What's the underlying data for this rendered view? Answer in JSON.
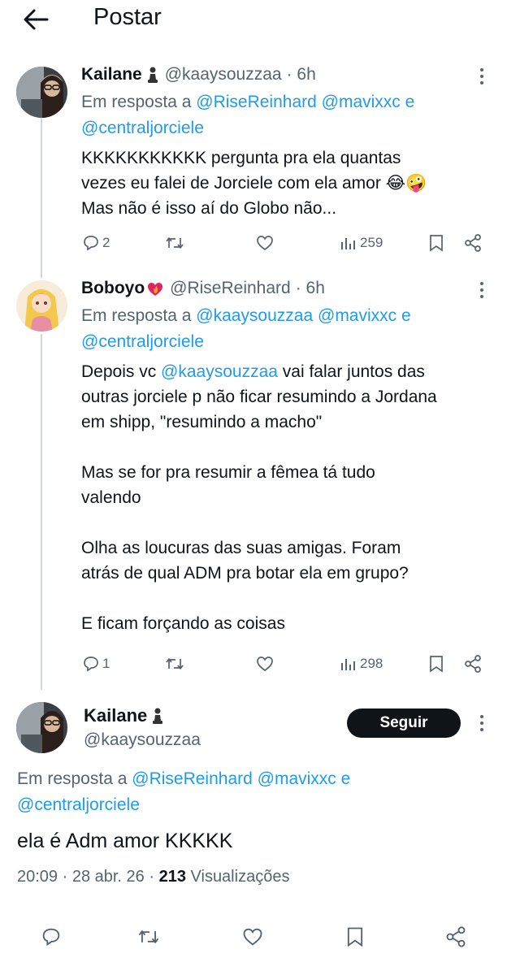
{
  "header": {
    "title": "Postar"
  },
  "posts": [
    {
      "name": "Kailane",
      "handle": "@kaaysouzzaa",
      "time": "· 6h",
      "reply_prefix": "Em resposta a",
      "reply_mentions": [
        "@RiseReinhard",
        "@mavixxc"
      ],
      "reply_and": "e",
      "reply_last": "@centraljorciele",
      "text": "KKKKKKKKKKK pergunta pra ela quantas\nvezes eu falei de Jorciele com ela amor 😂🤪\nMas não é isso aí do Globo não...",
      "replies": "2",
      "reposts": "",
      "views": "259"
    },
    {
      "name": "Boboyo",
      "handle": "@RiseReinhard",
      "time": "· 6h",
      "reply_prefix": "Em resposta a",
      "reply_mentions": [
        "@kaaysouzzaa",
        "@mavixxc"
      ],
      "reply_and": "e",
      "reply_last": "@centraljorciele",
      "text_start": "Depois vc",
      "text_mention": "@kaaysouzzaa",
      "text_rest": "vai falar juntos das\noutras jorciele p não ficar resumindo a Jordana\nem shipp, \"resumindo a macho\"\n\nMas se for pra resumir a fêmea tá tudo\nvalendo\n\nOlha as loucuras das suas amigas. Foram\natrás de qual ADM pra botar ela em grupo?\n\nE ficam forçando as coisas",
      "replies": "1",
      "views": "298"
    }
  ],
  "main_post": {
    "name": "Kailane",
    "handle": "@kaaysouzzaa",
    "follow_label": "Seguir",
    "reply_prefix": "Em resposta a",
    "reply_mentions": [
      "@RiseReinhard",
      "@mavixxc"
    ],
    "reply_and": "e",
    "reply_last": "@centraljorciele",
    "text": "ela é Adm amor KKKKK",
    "meta_time": "20:09 · 28 abr. 26 ·",
    "meta_views_count": "213",
    "meta_views_label": "Visualizações"
  },
  "colors": {
    "link": "#1d9bf0",
    "muted": "#536471",
    "text": "#0f1419",
    "line": "#cfd9de"
  },
  "icons": [
    "back-arrow-icon",
    "chess-pawn-icon",
    "heart-fire-icon",
    "more-icon",
    "reply-icon",
    "repost-icon",
    "like-icon",
    "views-icon",
    "bookmark-icon",
    "share-icon"
  ]
}
